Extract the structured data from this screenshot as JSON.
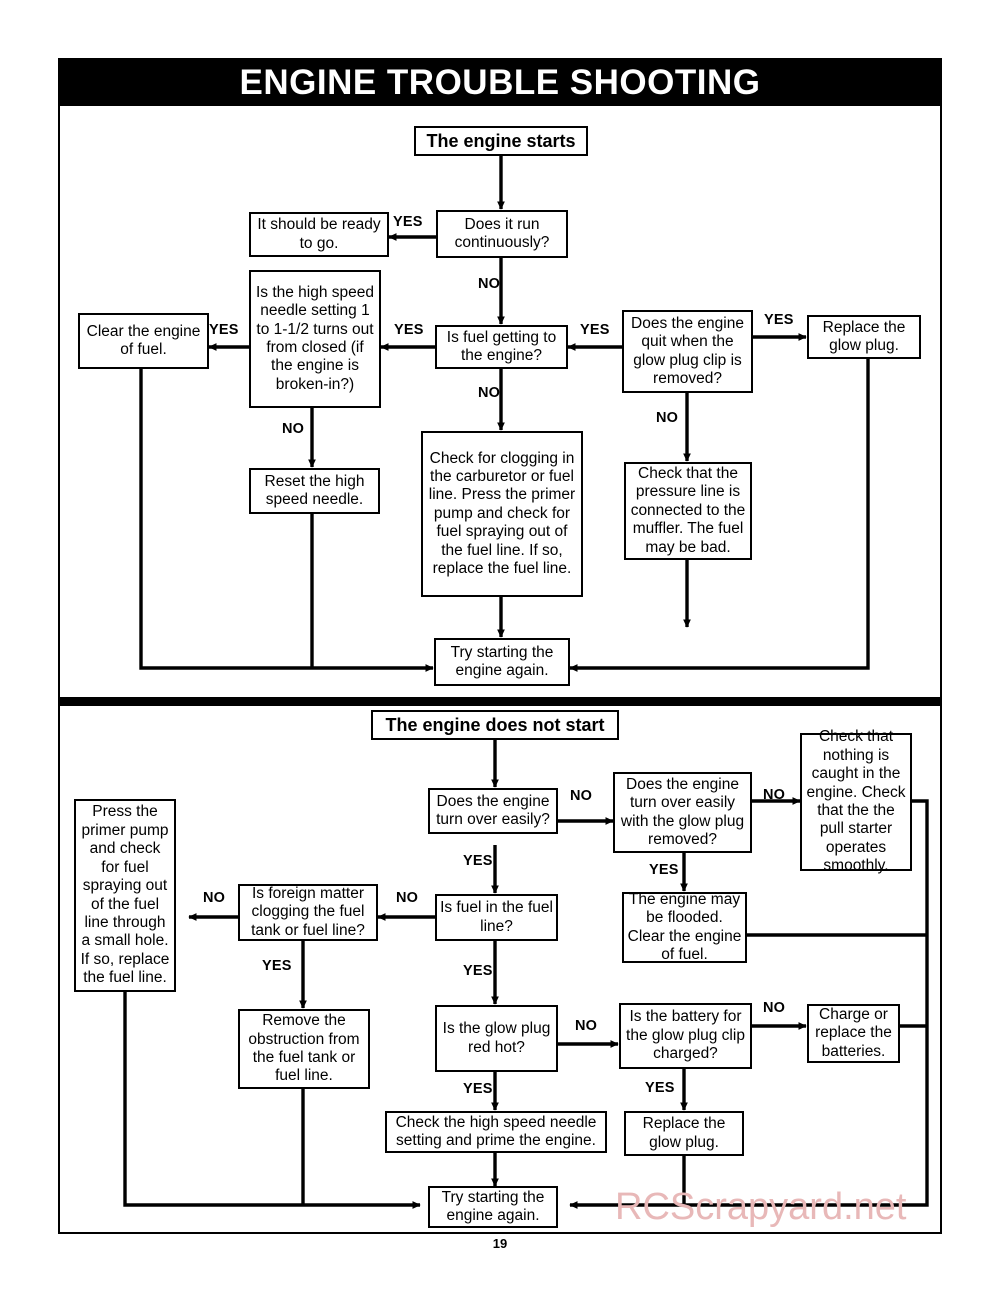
{
  "document": {
    "title": "ENGINE TROUBLE SHOOTING",
    "page_number": "19",
    "watermark": "RCScrapyard.net"
  },
  "labels": {
    "yes": "YES",
    "no": "NO"
  },
  "section_starts": {
    "header": "The engine starts",
    "nodes": {
      "run_cont": "Does it run continuously?",
      "ready": "It should be ready to go.",
      "fuel_getting": "Is fuel getting to the engine?",
      "high_speed_needle": "Is the high speed needle setting 1 to 1-1/2 turns out from closed (if the engine is broken-in?)",
      "clear_engine": "Clear the engine of fuel.",
      "reset_needle": "Reset the high speed needle.",
      "check_clogging": "Check for clogging in the carburetor or fuel line. Press the primer pump and check for fuel spraying out of the fuel line. If so, replace the fuel line.",
      "engine_quit": "Does the engine quit when the glow plug clip is removed?",
      "replace_plug": "Replace the glow plug.",
      "check_pressure": "Check that the pressure line is connected to the muffler. The fuel may be bad.",
      "try_again": "Try starting the engine again."
    }
  },
  "section_not_start": {
    "header": "The engine does not start",
    "nodes": {
      "turn_over": "Does the engine turn over easily?",
      "turn_over_plug": "Does the engine turn over easily with the glow plug removed?",
      "check_nothing": "Check that nothing is caught in the engine. Check that the the pull starter operates smoothly.",
      "fuel_in_line": "Is fuel in the fuel line?",
      "foreign_matter": "Is foreign matter clogging the fuel tank or fuel line?",
      "press_primer": "Press the primer pump and check for fuel spraying out of the fuel line through a small hole. If so, replace the fuel line.",
      "flooded": "The engine may be flooded. Clear the engine of fuel.",
      "remove_obstruction": "Remove the obstruction from the fuel tank or fuel line.",
      "glow_red_hot": "Is the glow plug red hot?",
      "battery_charged": "Is the battery for the glow plug clip charged?",
      "charge_batteries": "Charge or replace the batteries.",
      "check_needle_prime": "Check the high speed needle setting and prime the engine.",
      "replace_plug2": "Replace the glow plug.",
      "try_again2": "Try starting the engine again."
    }
  },
  "chart_data": {
    "type": "diagram",
    "title": "ENGINE TROUBLE SHOOTING",
    "subcharts": [
      {
        "name": "The engine starts",
        "edges": [
          {
            "from": "The engine starts",
            "to": "Does it run continuously?",
            "label": ""
          },
          {
            "from": "Does it run continuously?",
            "to": "It should be ready to go.",
            "label": "YES"
          },
          {
            "from": "Does it run continuously?",
            "to": "Is fuel getting to the engine?",
            "label": "NO"
          },
          {
            "from": "Is fuel getting to the engine?",
            "to": "Is the high speed needle setting 1 to 1-1/2 turns out from closed (if the engine is broken-in?)",
            "label": "YES"
          },
          {
            "from": "Is fuel getting to the engine?",
            "to": "Check for clogging in the carburetor or fuel line. Press the primer pump and check for fuel spraying out of the fuel line. If so, replace the fuel line.",
            "label": "NO"
          },
          {
            "from": "Is the high speed needle setting 1 to 1-1/2 turns out from closed (if the engine is broken-in?)",
            "to": "Clear the engine of fuel.",
            "label": "YES"
          },
          {
            "from": "Is the high speed needle setting 1 to 1-1/2 turns out from closed (if the engine is broken-in?)",
            "to": "Reset the high speed needle.",
            "label": "NO"
          },
          {
            "from": "Does the engine quit when the glow plug clip is removed?",
            "to": "Is fuel getting to the engine?",
            "label": "YES"
          },
          {
            "from": "Does the engine quit when the glow plug clip is removed?",
            "to": "Replace the glow plug.",
            "label": "YES"
          },
          {
            "from": "Does the engine quit when the glow plug clip is removed?",
            "to": "Check that the pressure line is connected to the muffler. The fuel may be bad.",
            "label": "NO"
          },
          {
            "from": "Clear the engine of fuel.",
            "to": "Try starting the engine again.",
            "label": ""
          },
          {
            "from": "Reset the high speed needle.",
            "to": "Try starting the engine again.",
            "label": ""
          },
          {
            "from": "Check for clogging in the carburetor or fuel line. Press the primer pump and check for fuel spraying out of the fuel line. If so, replace the fuel line.",
            "to": "Try starting the engine again.",
            "label": ""
          },
          {
            "from": "Check that the pressure line is connected to the muffler. The fuel may be bad.",
            "to": "Try starting the engine again.",
            "label": ""
          },
          {
            "from": "Replace the glow plug.",
            "to": "Try starting the engine again.",
            "label": ""
          }
        ]
      },
      {
        "name": "The engine does not start",
        "edges": [
          {
            "from": "The engine does not start",
            "to": "Does the engine turn over easily?",
            "label": ""
          },
          {
            "from": "Does the engine turn over easily?",
            "to": "Does the engine turn over easily with the glow plug removed?",
            "label": "NO"
          },
          {
            "from": "Does the engine turn over easily?",
            "to": "Is fuel in the fuel line?",
            "label": "YES"
          },
          {
            "from": "Does the engine turn over easily with the glow plug removed?",
            "to": "Check that nothing is caught in the engine. Check that the the pull starter operates smoothly.",
            "label": "NO"
          },
          {
            "from": "Does the engine turn over easily with the glow plug removed?",
            "to": "The engine may be flooded. Clear the engine of fuel.",
            "label": "YES"
          },
          {
            "from": "Is fuel in the fuel line?",
            "to": "Is foreign matter clogging the fuel tank or fuel line?",
            "label": "NO"
          },
          {
            "from": "Is fuel in the fuel line?",
            "to": "Is the glow plug red hot?",
            "label": "YES"
          },
          {
            "from": "Is foreign matter clogging the fuel tank or fuel line?",
            "to": "Press the primer pump and check for fuel spraying out of the fuel line through a small hole. If so, replace the fuel line.",
            "label": "NO"
          },
          {
            "from": "Is foreign matter clogging the fuel tank or fuel line?",
            "to": "Remove the obstruction from the fuel tank or fuel line.",
            "label": "YES"
          },
          {
            "from": "Is the glow plug red hot?",
            "to": "Is the battery for the glow plug clip charged?",
            "label": "NO"
          },
          {
            "from": "Is the glow plug red hot?",
            "to": "Check the high speed needle setting and prime the engine.",
            "label": "YES"
          },
          {
            "from": "Is the battery for the glow plug clip charged?",
            "to": "Charge or replace the batteries.",
            "label": "NO"
          },
          {
            "from": "Is the battery for the glow plug clip charged?",
            "to": "Replace the glow plug.",
            "label": "YES"
          },
          {
            "from": "Check the high speed needle setting and prime the engine.",
            "to": "Try starting the engine again.",
            "label": ""
          },
          {
            "from": "Replace the glow plug.",
            "to": "Try starting the engine again.",
            "label": ""
          },
          {
            "from": "Press the primer pump and check for fuel spraying out of the fuel line through a small hole. If so, replace the fuel line.",
            "to": "Try starting the engine again.",
            "label": ""
          },
          {
            "from": "Remove the obstruction from the fuel tank or fuel line.",
            "to": "Try starting the engine again.",
            "label": ""
          },
          {
            "from": "Check that nothing is caught in the engine. Check that the the pull starter operates smoothly.",
            "to": "Try starting the engine again.",
            "label": ""
          },
          {
            "from": "The engine may be flooded. Clear the engine of fuel.",
            "to": "Try starting the engine again.",
            "label": ""
          },
          {
            "from": "Charge or replace the batteries.",
            "to": "Try starting the engine again.",
            "label": ""
          }
        ]
      }
    ]
  }
}
